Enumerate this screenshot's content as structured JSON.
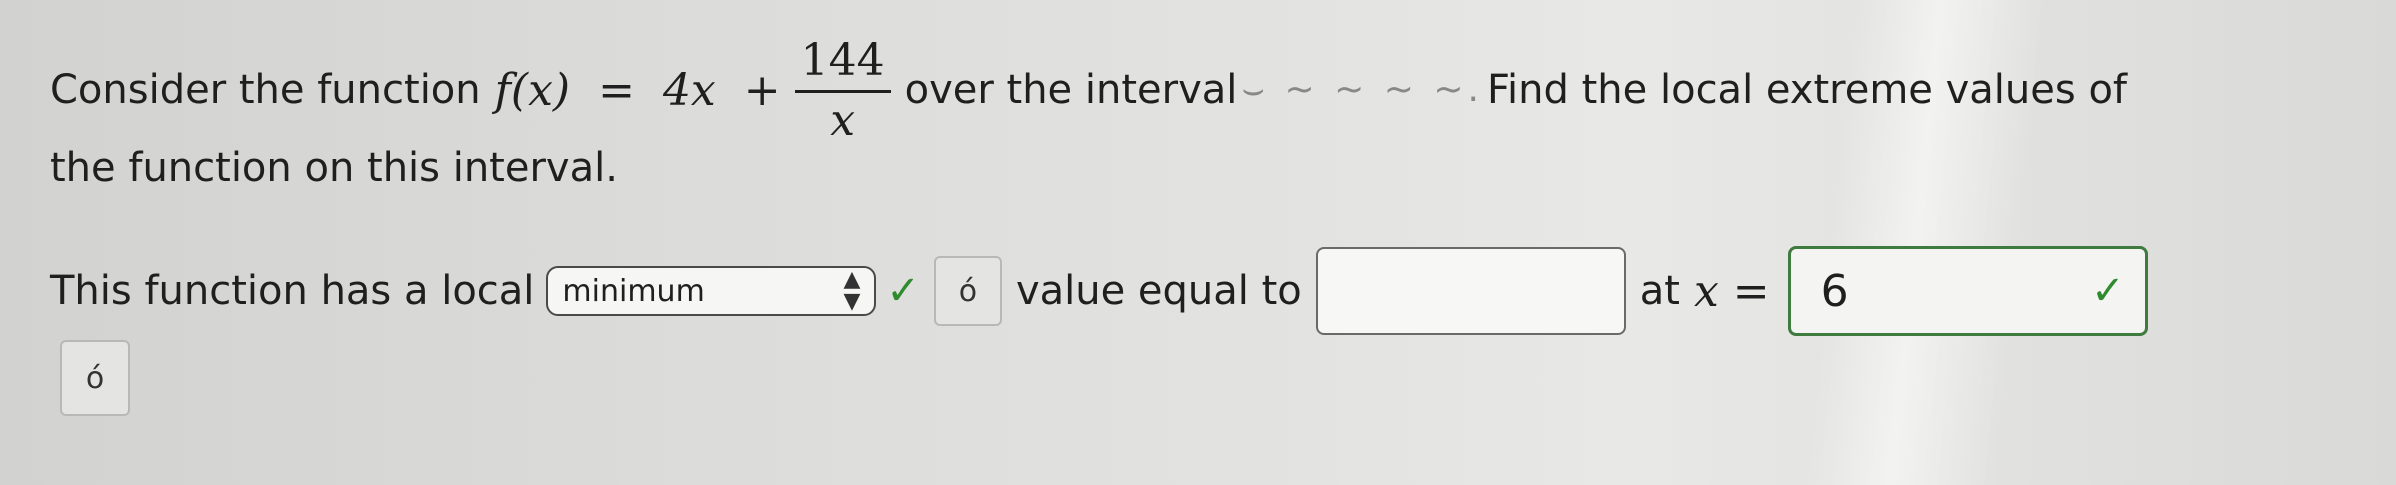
{
  "question": {
    "lead": "Consider the function",
    "function_lhs": "f(x)",
    "equals": "=",
    "term1": "4x",
    "plus": "+",
    "frac_num": "144",
    "frac_den": "x",
    "mid": "over the interval",
    "interval_glyphs": "⌣ ~ ~ ~ ~.",
    "tail": "Find the local extreme values of",
    "line2": "the function on this interval."
  },
  "answer_row": {
    "lead": "This function has a local",
    "select_value": "minimum",
    "select_check": "✓",
    "key_icon": "ó",
    "value_text": "value equal to",
    "value_input": "",
    "at_text": "at",
    "x_var": "x",
    "equals": "=",
    "x_value": "6",
    "x_check": "✓"
  },
  "bottom_key_icon": "ó",
  "colors": {
    "check_green": "#2e8b2e",
    "answer_border": "#3f7a3f"
  }
}
